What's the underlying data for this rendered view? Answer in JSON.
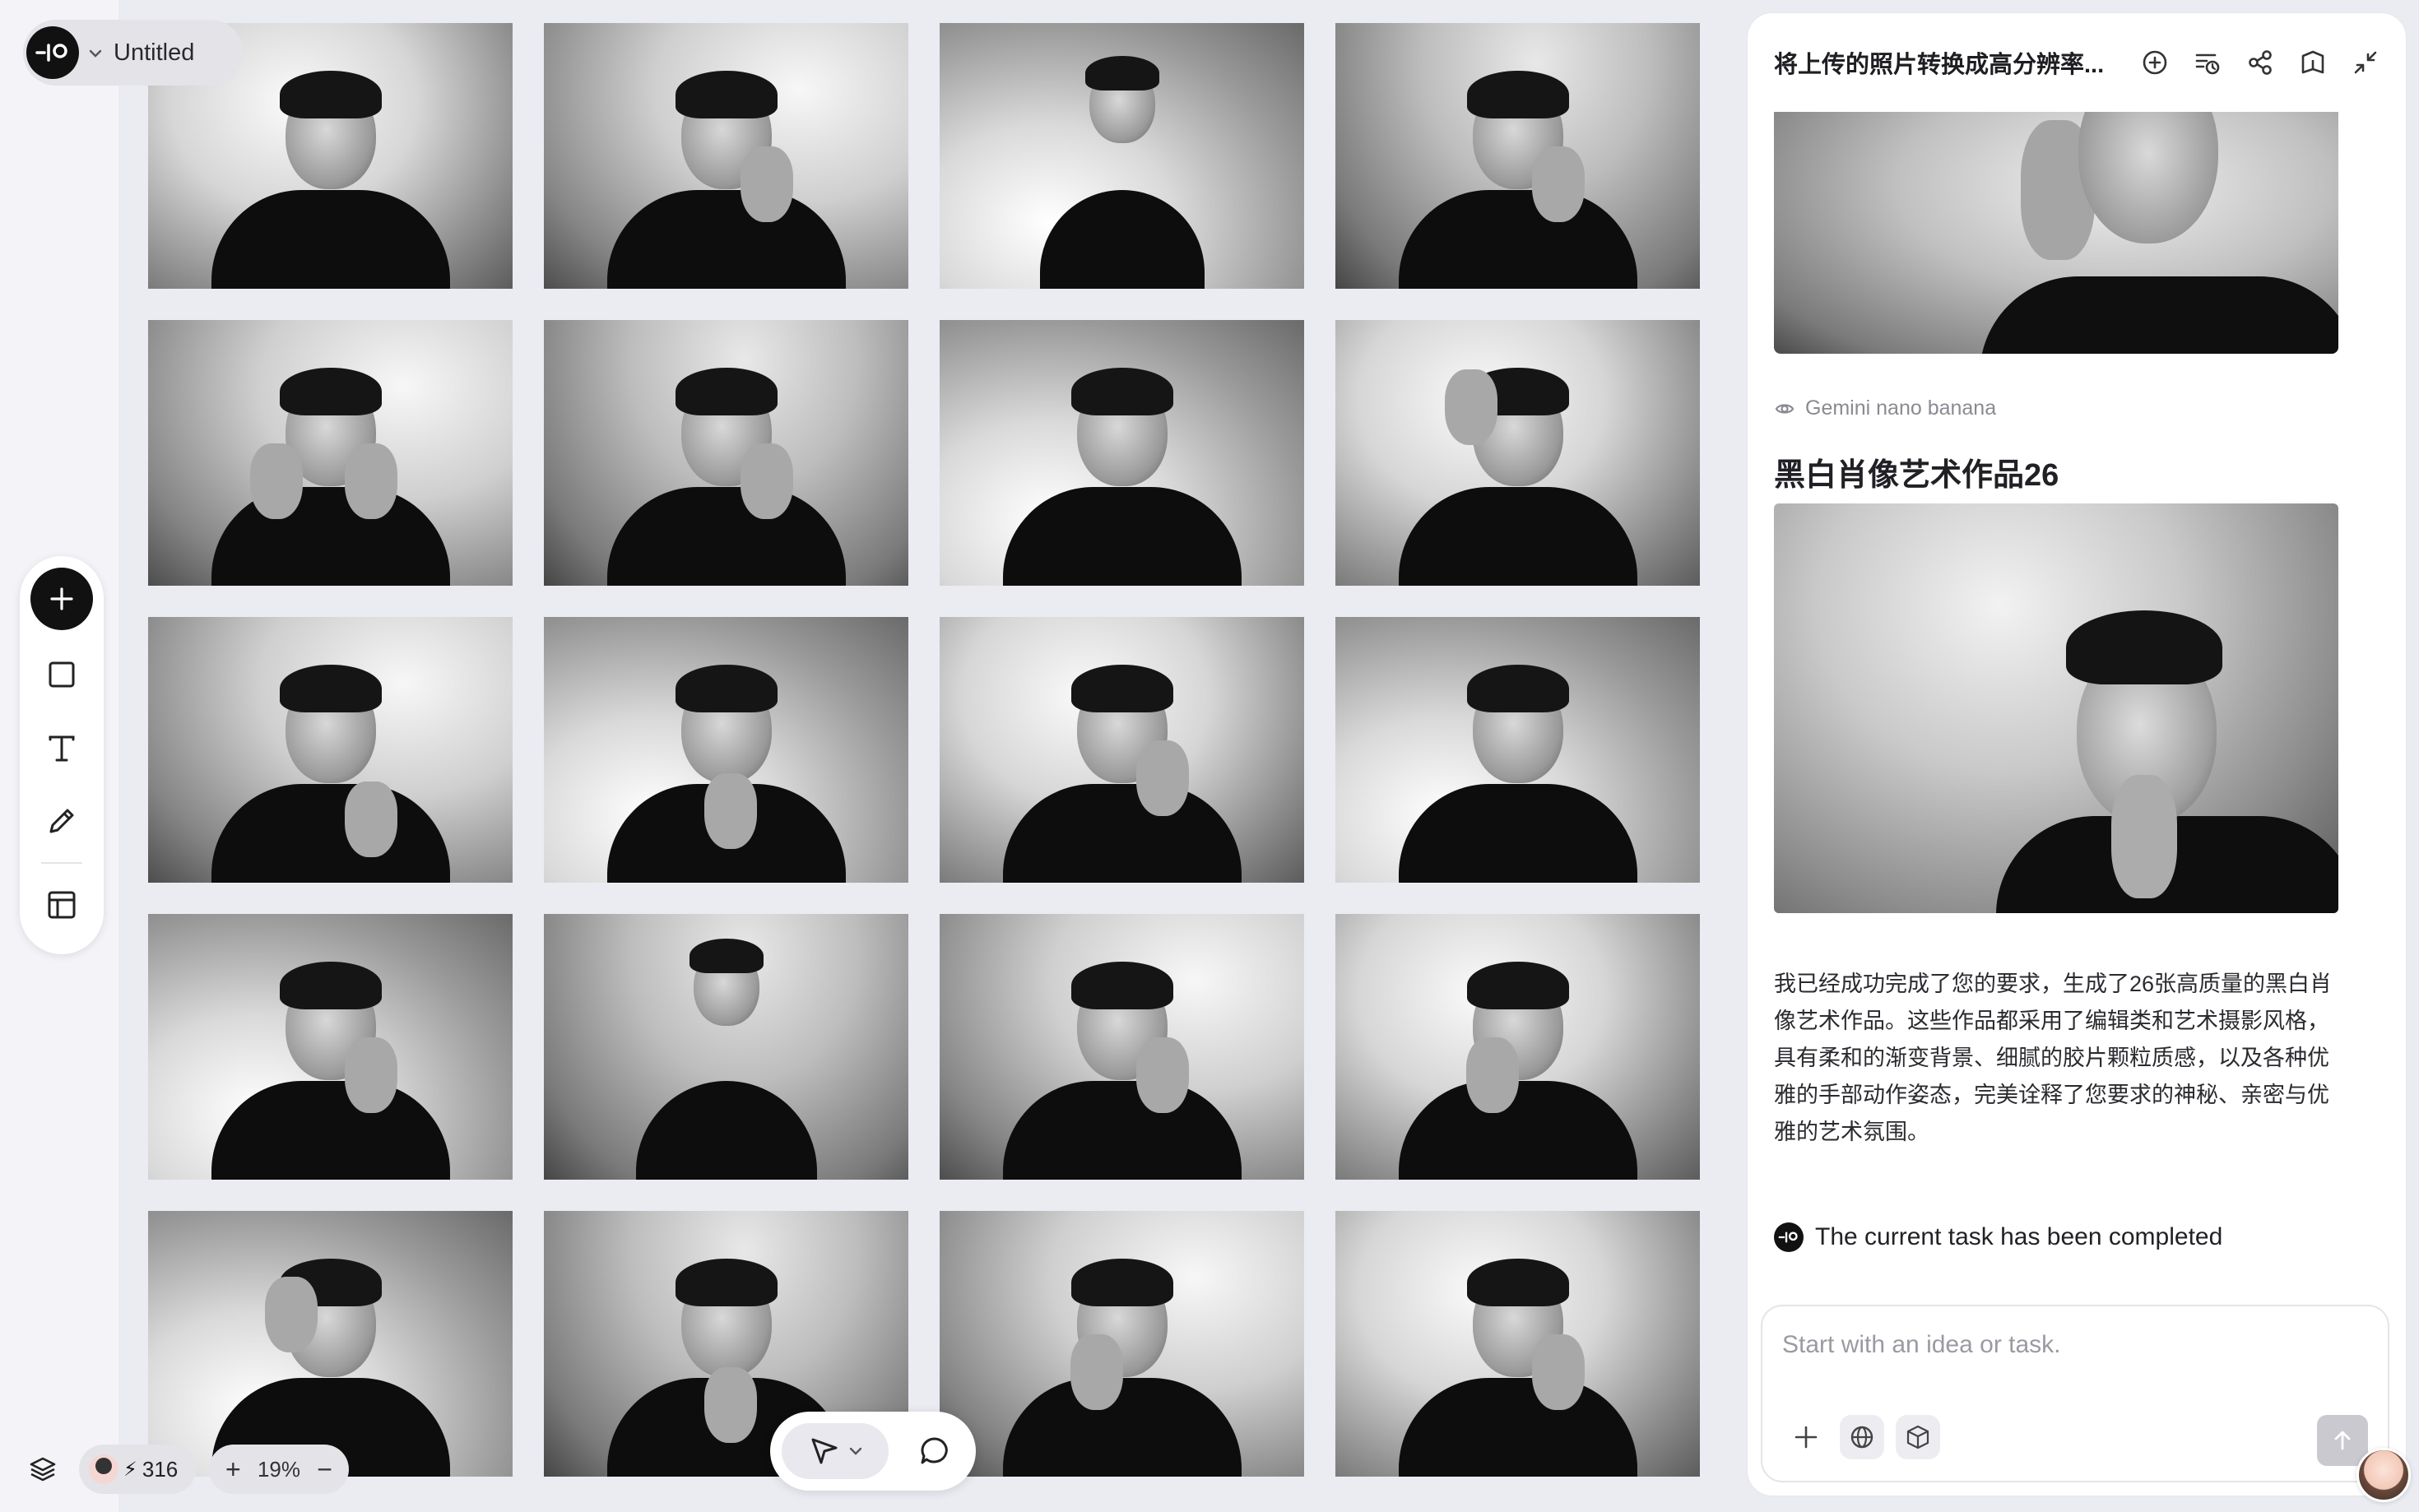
{
  "project": {
    "name": "Untitled"
  },
  "toolbar": {
    "tools": [
      "add",
      "rectangle",
      "text",
      "pencil",
      "layout"
    ]
  },
  "status_bar": {
    "credits": "316",
    "zoom": "19%",
    "zoom_in": "+",
    "zoom_out": "−"
  },
  "grid": {
    "rows": 5,
    "columns": 4
  },
  "panel": {
    "title": "将上传的照片转换成高分辨率...",
    "model_name": "Gemini nano banana",
    "artwork_title": "黑白肖像艺术作品26",
    "description": "我已经成功完成了您的要求，生成了26张高质量的黑白肖像艺术作品。这些作品都采用了编辑类和艺术摄影风格，具有柔和的渐变背景、细腻的胶片颗粒质感，以及各种优雅的手部动作姿态，完美诠释了您要求的神秘、亲密与优雅的艺术氛围。",
    "status_text": "The current task has been completed",
    "composer_placeholder": "Start with an idea or task."
  },
  "colors": {
    "canvas_bg": "#ebebf2",
    "panel_bg": "#ffffff",
    "accent_dark": "#111111"
  }
}
